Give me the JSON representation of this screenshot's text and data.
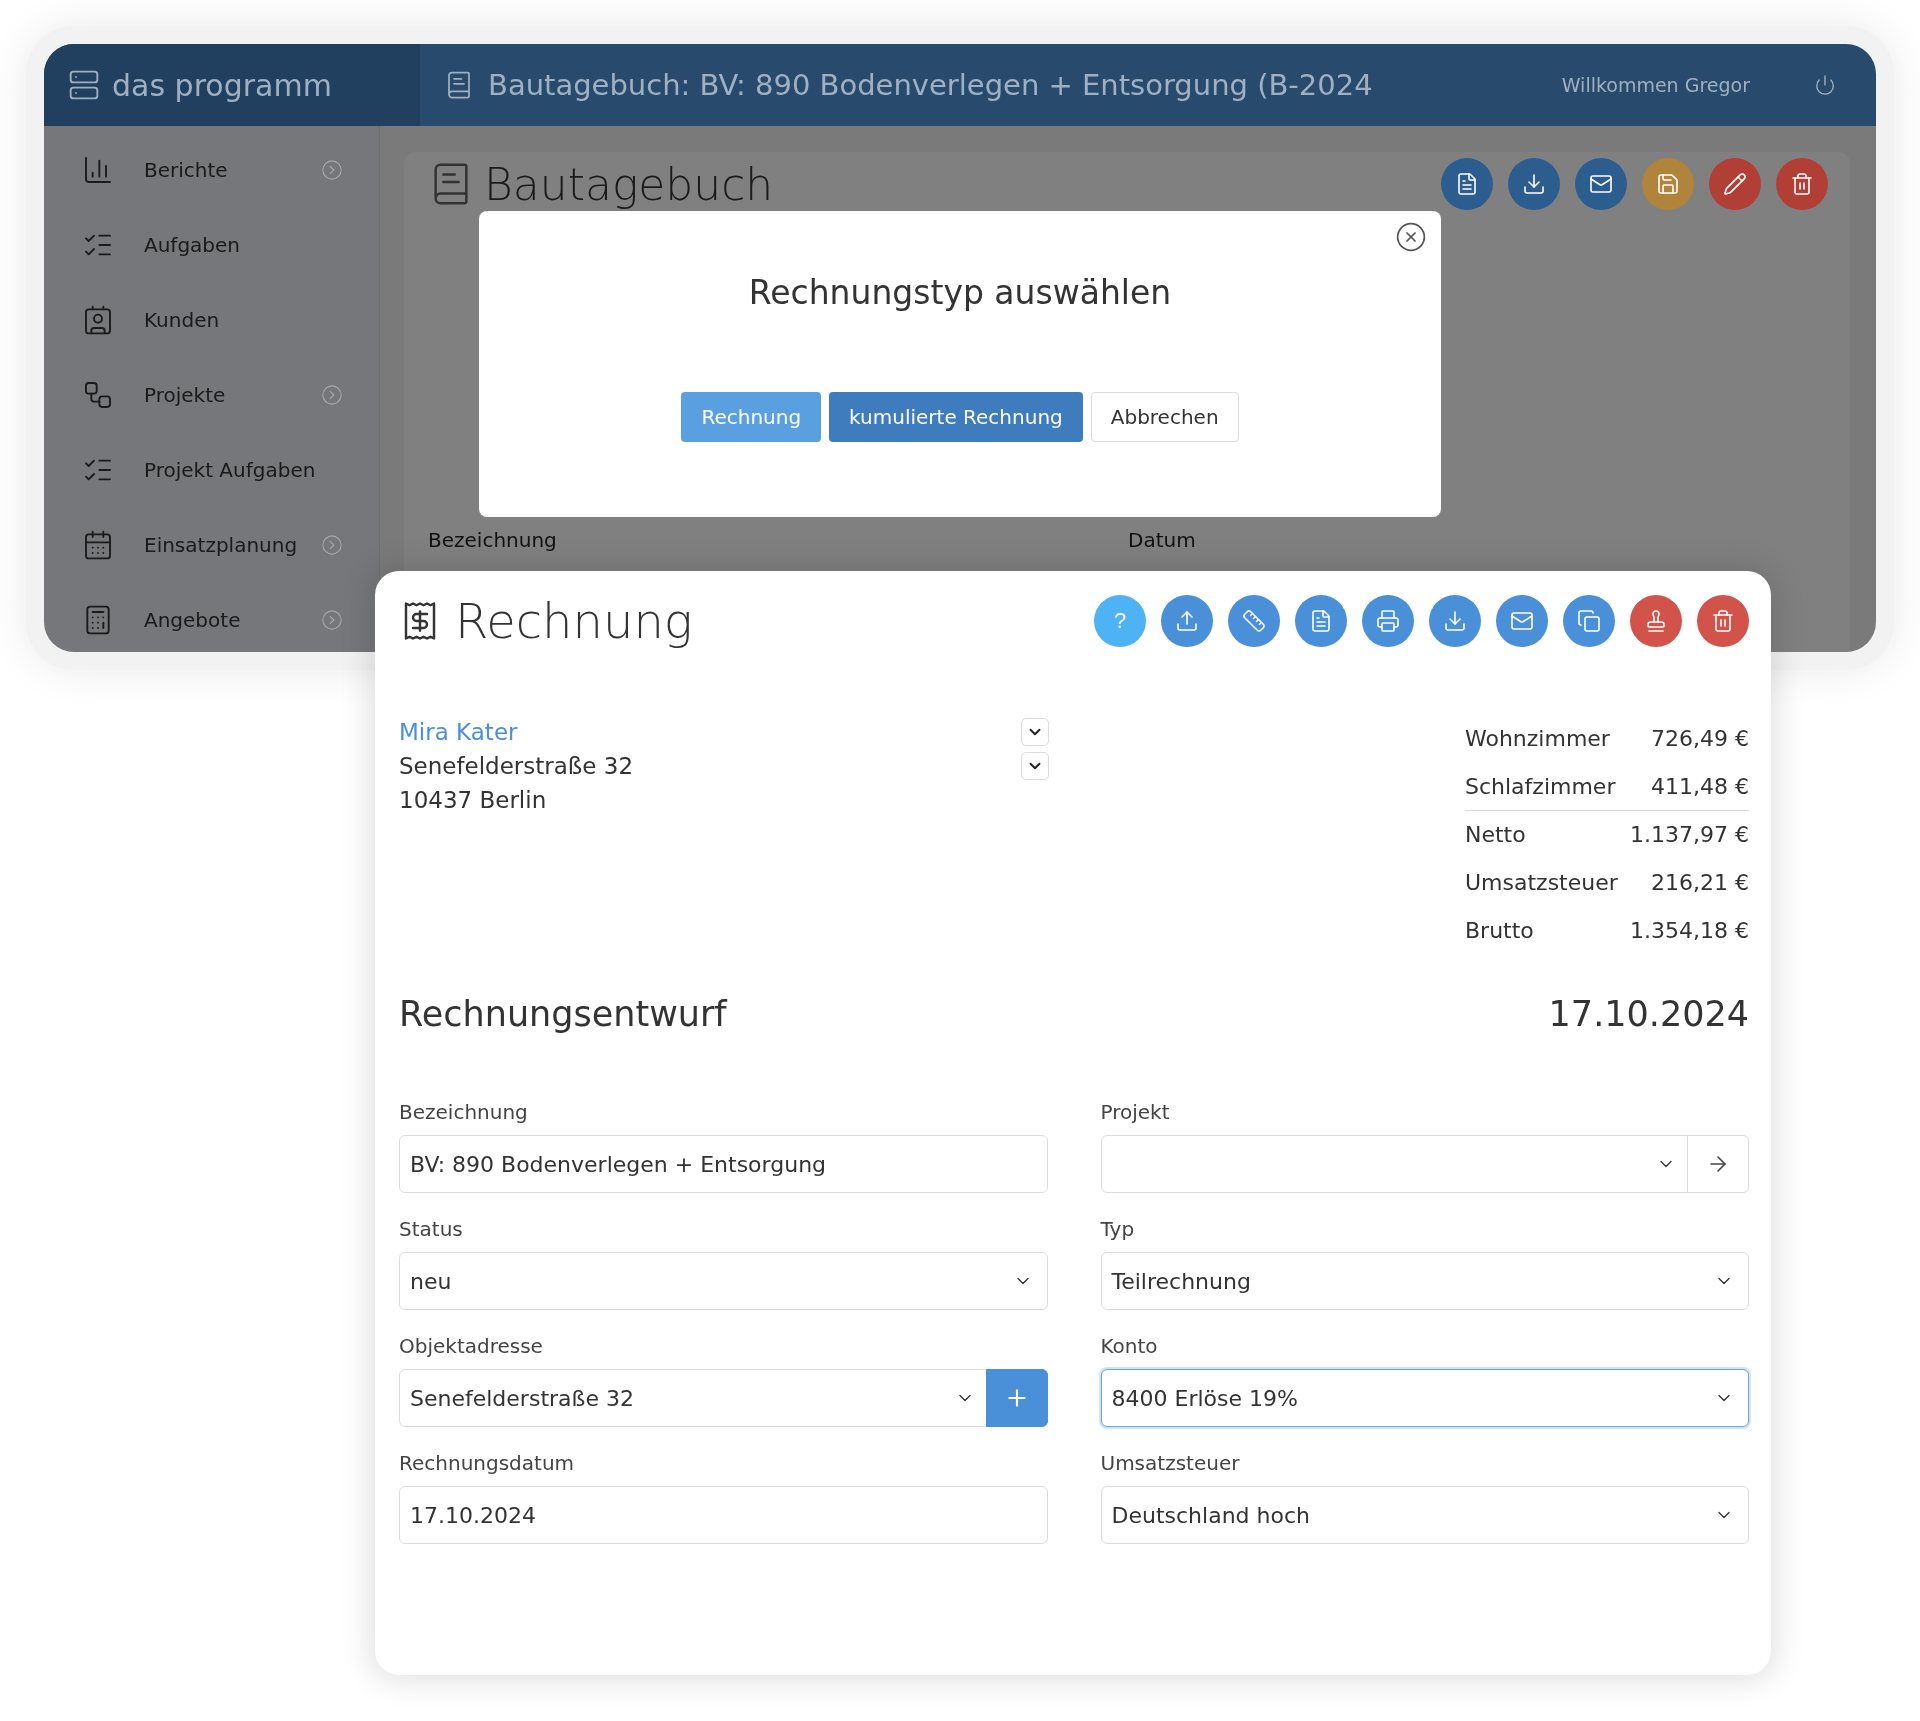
{
  "app": {
    "brand": "das programm",
    "title": "Bautagebuch: BV: 890 Bodenverlegen + Entsorgung (B-2024",
    "welcome": "Willkommen Gregor"
  },
  "sidebar": {
    "items": [
      {
        "label": "Berichte",
        "kind": "chart",
        "expandable": true
      },
      {
        "label": "Aufgaben",
        "kind": "tasks",
        "expandable": false
      },
      {
        "label": "Kunden",
        "kind": "contact",
        "expandable": false
      },
      {
        "label": "Projekte",
        "kind": "workflow",
        "expandable": true
      },
      {
        "label": "Projekt Aufgaben",
        "kind": "tasks",
        "expandable": false
      },
      {
        "label": "Einsatzplanung",
        "kind": "calendar",
        "expandable": true
      },
      {
        "label": "Angebote",
        "kind": "calculator",
        "expandable": true
      }
    ]
  },
  "diary": {
    "title": "Bautagebuch",
    "actions": [
      {
        "kind": "pdf",
        "color": "#2b5d8f"
      },
      {
        "kind": "download",
        "color": "#2b5d8f"
      },
      {
        "kind": "mail",
        "color": "#2b5d8f"
      },
      {
        "kind": "save",
        "color": "#b0843b"
      },
      {
        "kind": "edit",
        "color": "#b23f36"
      },
      {
        "kind": "trash",
        "color": "#b23f36"
      }
    ],
    "columns": [
      "Bezeichnung",
      "Datum"
    ]
  },
  "dialog": {
    "title": "Rechnungstyp auswählen",
    "buttons": [
      {
        "label": "Rechnung",
        "kind": "primary"
      },
      {
        "label": "kumulierte Rechnung",
        "kind": "strong"
      },
      {
        "label": "Abbrechen",
        "kind": "plain"
      }
    ]
  },
  "invoice": {
    "title": "Rechnung",
    "actions": [
      {
        "kind": "help",
        "label": "?",
        "color": "#4db3f5"
      },
      {
        "kind": "upload",
        "color": "#4a90d9"
      },
      {
        "kind": "ruler",
        "color": "#4a90d9"
      },
      {
        "kind": "pdf",
        "color": "#4a90d9"
      },
      {
        "kind": "print",
        "color": "#4a90d9"
      },
      {
        "kind": "download",
        "color": "#4a90d9"
      },
      {
        "kind": "mail",
        "color": "#4a90d9"
      },
      {
        "kind": "copy",
        "color": "#4a90d9"
      },
      {
        "kind": "stamp",
        "color": "#d2534a"
      },
      {
        "kind": "trash",
        "color": "#d2534a"
      }
    ],
    "customer": {
      "name": "Mira Kater",
      "street": "Senefelderstraße 32",
      "city": "10437 Berlin"
    },
    "totals": [
      {
        "label": "Wohnzimmer",
        "value": "726,49 €",
        "divider": false
      },
      {
        "label": "Schlafzimmer",
        "value": "411,48 €",
        "divider": true
      },
      {
        "label": "Netto",
        "value": "1.137,97 €",
        "divider": false
      },
      {
        "label": "Umsatzsteuer",
        "value": "216,21 €",
        "divider": false
      },
      {
        "label": "Brutto",
        "value": "1.354,18 €",
        "divider": false
      }
    ],
    "status_title": "Rechnungsentwurf",
    "date": "17.10.2024",
    "fields": [
      {
        "label": "Bezeichnung",
        "kind": "text",
        "value": "BV: 890 Bodenverlegen + Entsorgung",
        "focused": false
      },
      {
        "label": "Projekt",
        "kind": "select-link",
        "focused": false
      },
      {
        "label": "Status",
        "kind": "select",
        "value": "neu",
        "focused": false
      },
      {
        "label": "Typ",
        "kind": "select",
        "value": "Teilrechnung",
        "focused": false
      },
      {
        "label": "Objektadresse",
        "kind": "select-add",
        "value": "Senefelderstraße 32",
        "focused": false
      },
      {
        "label": "Konto",
        "kind": "select",
        "value": "8400 Erlöse 19%",
        "focused": true
      },
      {
        "label": "Rechnungsdatum",
        "kind": "text",
        "value": "17.10.2024",
        "focused": false
      },
      {
        "label": "Umsatzsteuer",
        "kind": "select",
        "value": "Deutschland hoch",
        "focused": false
      }
    ]
  }
}
